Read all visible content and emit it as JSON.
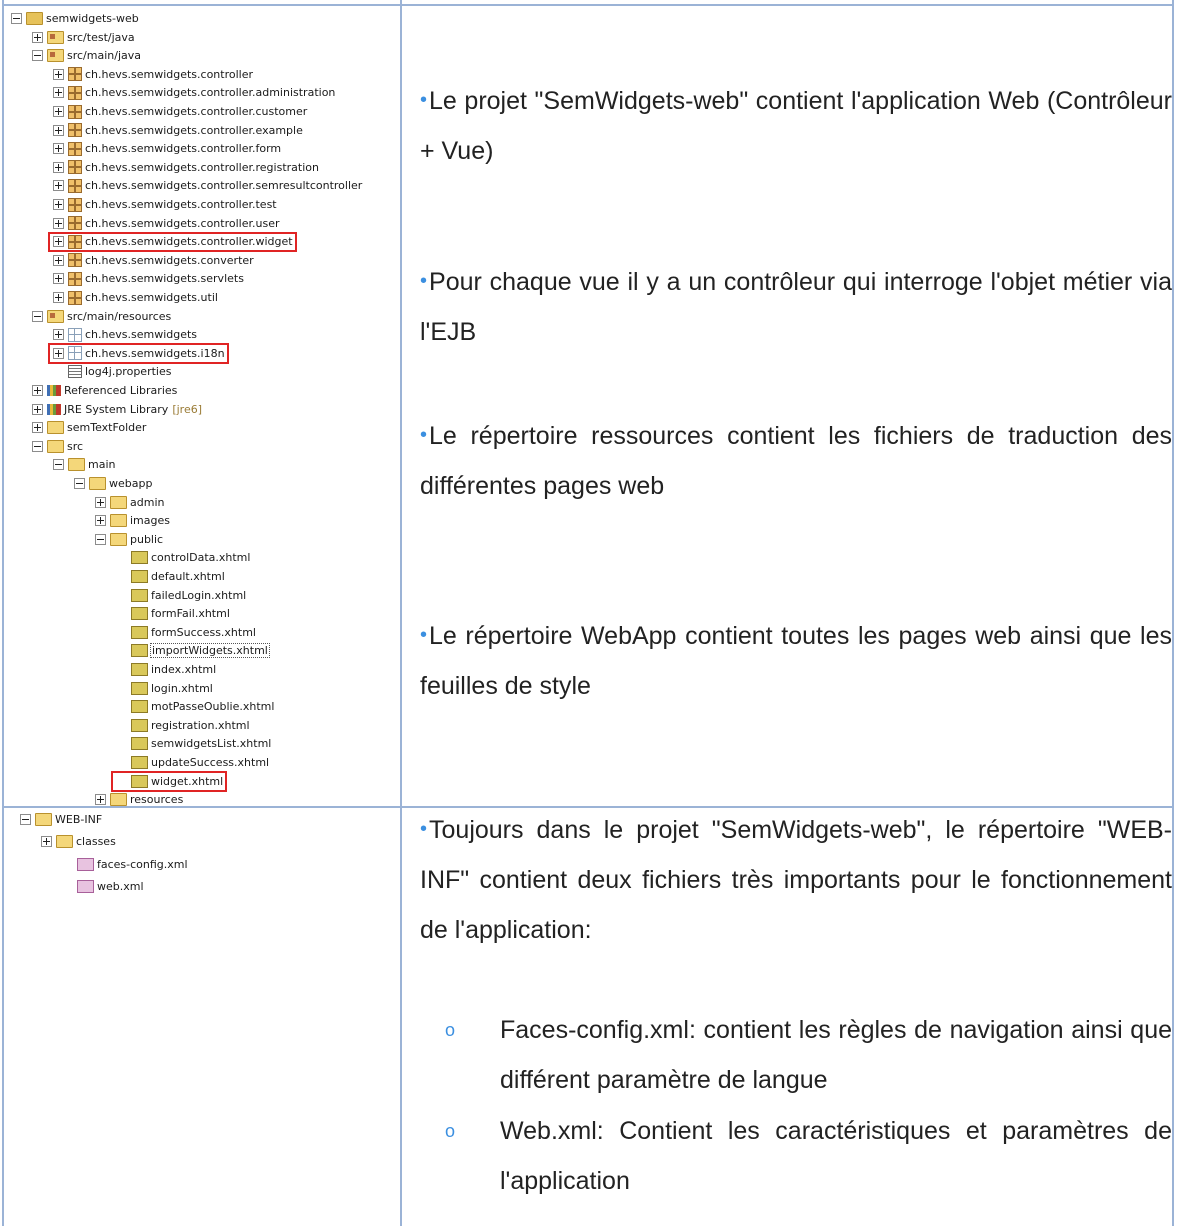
{
  "tree1": [
    {
      "label": "semwidgets-web",
      "depth": 0,
      "toggle": "minus",
      "icon": "project-folder-icon"
    },
    {
      "label": "src/test/java",
      "depth": 1,
      "toggle": "plus",
      "icon": "source-folder-icon"
    },
    {
      "label": "src/main/java",
      "depth": 1,
      "toggle": "minus",
      "icon": "source-folder-icon"
    },
    {
      "label": "ch.hevs.semwidgets.controller",
      "depth": 2,
      "toggle": "plus",
      "icon": "package-icon"
    },
    {
      "label": "ch.hevs.semwidgets.controller.administration",
      "depth": 2,
      "toggle": "plus",
      "icon": "package-icon"
    },
    {
      "label": "ch.hevs.semwidgets.controller.customer",
      "depth": 2,
      "toggle": "plus",
      "icon": "package-icon"
    },
    {
      "label": "ch.hevs.semwidgets.controller.example",
      "depth": 2,
      "toggle": "plus",
      "icon": "package-icon"
    },
    {
      "label": "ch.hevs.semwidgets.controller.form",
      "depth": 2,
      "toggle": "plus",
      "icon": "package-icon"
    },
    {
      "label": "ch.hevs.semwidgets.controller.registration",
      "depth": 2,
      "toggle": "plus",
      "icon": "package-icon"
    },
    {
      "label": "ch.hevs.semwidgets.controller.semresultcontroller",
      "depth": 2,
      "toggle": "plus",
      "icon": "package-icon"
    },
    {
      "label": "ch.hevs.semwidgets.controller.test",
      "depth": 2,
      "toggle": "plus",
      "icon": "package-icon"
    },
    {
      "label": "ch.hevs.semwidgets.controller.user",
      "depth": 2,
      "toggle": "plus",
      "icon": "package-icon"
    },
    {
      "label": "ch.hevs.semwidgets.controller.widget",
      "depth": 2,
      "toggle": "plus",
      "icon": "package-icon",
      "highlight": true
    },
    {
      "label": "ch.hevs.semwidgets.converter",
      "depth": 2,
      "toggle": "plus",
      "icon": "package-icon"
    },
    {
      "label": "ch.hevs.semwidgets.servlets",
      "depth": 2,
      "toggle": "plus",
      "icon": "package-icon"
    },
    {
      "label": "ch.hevs.semwidgets.util",
      "depth": 2,
      "toggle": "plus",
      "icon": "package-icon"
    },
    {
      "label": "src/main/resources",
      "depth": 1,
      "toggle": "minus",
      "icon": "source-folder-icon"
    },
    {
      "label": "ch.hevs.semwidgets",
      "depth": 2,
      "toggle": "plus",
      "icon": "resource-package-icon"
    },
    {
      "label": "ch.hevs.semwidgets.i18n",
      "depth": 2,
      "toggle": "plus",
      "icon": "resource-package-icon",
      "highlight": true
    },
    {
      "label": "log4j.properties",
      "depth": 2,
      "toggle": "none",
      "icon": "properties-file-icon"
    },
    {
      "label": "Referenced Libraries",
      "depth": 1,
      "toggle": "plus",
      "icon": "library-icon"
    },
    {
      "label": "JRE System Library",
      "decor": "[jre6]",
      "depth": 1,
      "toggle": "plus",
      "icon": "library-icon"
    },
    {
      "label": "semTextFolder",
      "depth": 1,
      "toggle": "plus",
      "icon": "folder-icon"
    },
    {
      "label": "src",
      "depth": 1,
      "toggle": "minus",
      "icon": "folder-icon"
    },
    {
      "label": "main",
      "depth": 2,
      "toggle": "minus",
      "icon": "folder-icon"
    },
    {
      "label": "webapp",
      "depth": 3,
      "toggle": "minus",
      "icon": "folder-icon"
    },
    {
      "label": "admin",
      "depth": 4,
      "toggle": "plus",
      "icon": "folder-icon"
    },
    {
      "label": "images",
      "depth": 4,
      "toggle": "plus",
      "icon": "folder-icon"
    },
    {
      "label": "public",
      "depth": 4,
      "toggle": "minus",
      "icon": "folder-icon"
    },
    {
      "label": "controlData.xhtml",
      "depth": 5,
      "toggle": "none",
      "icon": "xhtml-file-icon"
    },
    {
      "label": "default.xhtml",
      "depth": 5,
      "toggle": "none",
      "icon": "xhtml-file-icon"
    },
    {
      "label": "failedLogin.xhtml",
      "depth": 5,
      "toggle": "none",
      "icon": "xhtml-file-icon"
    },
    {
      "label": "formFail.xhtml",
      "depth": 5,
      "toggle": "none",
      "icon": "xhtml-file-icon"
    },
    {
      "label": "formSuccess.xhtml",
      "depth": 5,
      "toggle": "none",
      "icon": "xhtml-file-icon"
    },
    {
      "label": "importWidgets.xhtml",
      "depth": 5,
      "toggle": "none",
      "icon": "xhtml-file-icon",
      "selected": true
    },
    {
      "label": "index.xhtml",
      "depth": 5,
      "toggle": "none",
      "icon": "xhtml-file-icon"
    },
    {
      "label": "login.xhtml",
      "depth": 5,
      "toggle": "none",
      "icon": "xhtml-file-icon"
    },
    {
      "label": "motPasseOublie.xhtml",
      "depth": 5,
      "toggle": "none",
      "icon": "xhtml-file-icon"
    },
    {
      "label": "registration.xhtml",
      "depth": 5,
      "toggle": "none",
      "icon": "xhtml-file-icon"
    },
    {
      "label": "semwidgetsList.xhtml",
      "depth": 5,
      "toggle": "none",
      "icon": "xhtml-file-icon"
    },
    {
      "label": "updateSuccess.xhtml",
      "depth": 5,
      "toggle": "none",
      "icon": "xhtml-file-icon"
    },
    {
      "label": "widget.xhtml",
      "depth": 5,
      "toggle": "none",
      "icon": "xhtml-file-icon",
      "highlight": true
    },
    {
      "label": "resources",
      "depth": 4,
      "toggle": "plus",
      "icon": "folder-icon"
    }
  ],
  "tree2": [
    {
      "label": "WEB-INF",
      "depth": 0,
      "toggle": "minus",
      "icon": "folder-icon"
    },
    {
      "label": "classes",
      "depth": 1,
      "toggle": "plus",
      "icon": "folder-icon"
    },
    {
      "label": "faces-config.xml",
      "depth": 2,
      "toggle": "none",
      "icon": "xml-file-icon"
    },
    {
      "label": "web.xml",
      "depth": 2,
      "toggle": "none",
      "icon": "xml-file-icon"
    }
  ],
  "paragraphs": {
    "p1": "Le projet \"SemWidgets-web\" contient l'application Web (Contrôleur + Vue)",
    "p2": "Pour chaque vue il y a un contrôleur qui interroge l'objet métier via l'EJB",
    "p3": "Le répertoire ressources contient les fichiers de traduction des différentes pages web",
    "p4": "Le répertoire WebApp contient toutes les pages web ainsi que les feuilles de style",
    "p5": "Toujours dans le projet \"SemWidgets-web\", le répertoire \"WEB-INF\" contient deux fichiers très importants pour le fonctionnement de l'application:"
  },
  "subitems": {
    "s1": "Faces-config.xml: contient les règles de navigation ainsi que différent paramètre de langue",
    "s2": "Web.xml: Contient les caractéristiques et paramètres de l'application"
  },
  "symbols": {
    "bullet": "•",
    "sub_bullet": "o"
  },
  "colors": {
    "border": "#9bb3d6",
    "highlight": "#e02424",
    "bullet": "#3b8fe0"
  }
}
